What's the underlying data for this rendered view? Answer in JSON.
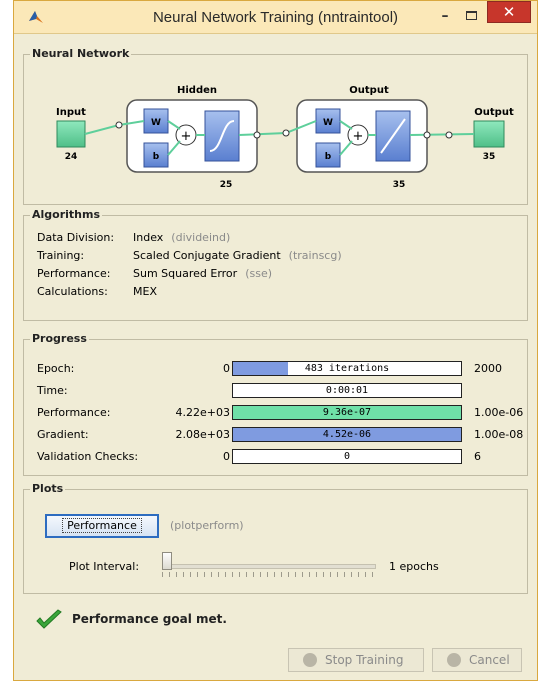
{
  "window": {
    "title": "Neural Network Training (nntraintool)",
    "minimize_glyph": "–",
    "close_glyph": "✕"
  },
  "neural_network": {
    "panel_title": "Neural Network",
    "input_label": "Input",
    "input_size": "24",
    "hidden_label": "Hidden",
    "hidden_size": "25",
    "output_layer_label": "Output",
    "output_layer_size": "35",
    "output_label": "Output",
    "output_size": "35",
    "weight_label": "W",
    "bias_label": "b",
    "sum_glyph": "+"
  },
  "algorithms": {
    "panel_title": "Algorithms",
    "rows": [
      {
        "label": "Data Division:",
        "value": "Index",
        "function": "(divideind)"
      },
      {
        "label": "Training:",
        "value": "Scaled Conjugate Gradient",
        "function": "(trainscg)"
      },
      {
        "label": "Performance:",
        "value": "Sum Squared Error",
        "function": "(sse)"
      },
      {
        "label": "Calculations:",
        "value": "MEX",
        "function": ""
      }
    ]
  },
  "progress": {
    "panel_title": "Progress",
    "rows": [
      {
        "label": "Epoch:",
        "min": "0",
        "value": "483 iterations",
        "max": "2000",
        "fill_fraction": 0.24,
        "fill_color": "#7f9be0"
      },
      {
        "label": "Time:",
        "min": "",
        "value": "0:00:01",
        "max": "",
        "fill_fraction": 0,
        "fill_color": "#ffffff"
      },
      {
        "label": "Performance:",
        "min": "4.22e+03",
        "value": "9.36e-07",
        "max": "1.00e-06",
        "fill_fraction": 1.0,
        "fill_color": "#6fe0a8"
      },
      {
        "label": "Gradient:",
        "min": "2.08e+03",
        "value": "4.52e-06",
        "max": "1.00e-08",
        "fill_fraction": 1.0,
        "fill_color": "#7f9be0"
      },
      {
        "label": "Validation Checks:",
        "min": "0",
        "value": "0",
        "max": "6",
        "fill_fraction": 0,
        "fill_color": "#ffffff"
      }
    ]
  },
  "plots": {
    "panel_title": "Plots",
    "performance_button": "Performance",
    "performance_function": "(plotperform)",
    "plot_interval_label": "Plot Interval:",
    "plot_interval_value": "1 epochs",
    "slider_fraction": 0
  },
  "status": {
    "icon": "checkmark-icon",
    "text": "Performance goal met."
  },
  "footer": {
    "stop_training_label": "Stop Training",
    "cancel_label": "Cancel"
  },
  "colors": {
    "accent_blue": "#2d6cc0",
    "close_red": "#c7362b",
    "layer_green": "#6fd6a4",
    "window_bg": "#f0ecd6"
  }
}
